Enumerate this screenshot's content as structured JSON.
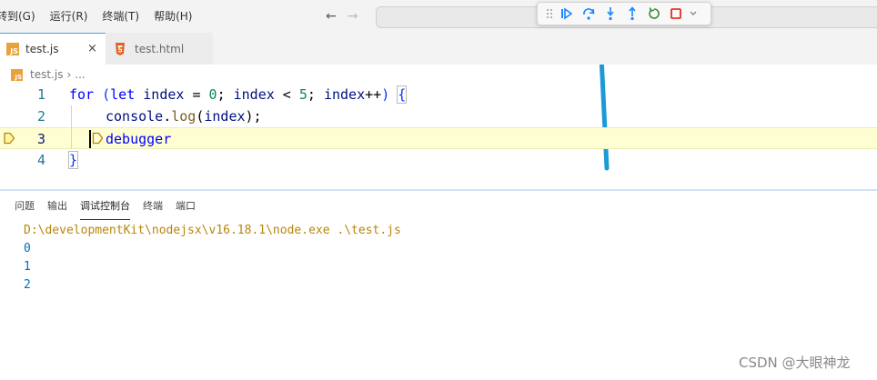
{
  "menu": {
    "items": [
      "转到(G)",
      "运行(R)",
      "终端(T)",
      "帮助(H)"
    ]
  },
  "nav": {
    "back": "←",
    "forward": "→"
  },
  "tabs": [
    {
      "label": "test.js",
      "close": "×"
    },
    {
      "label": "test.html"
    }
  ],
  "breadcrumb": {
    "file": "test.js",
    "separator": "›",
    "rest": "..."
  },
  "icons": {
    "js_glyph": "JS",
    "continue": "continue-icon",
    "step_over": "step-over-icon",
    "step_into": "step-into-icon",
    "step_out": "step-out-icon",
    "restart": "restart-icon",
    "stop": "stop-icon"
  },
  "editor": {
    "lines": [
      {
        "number": "1"
      },
      {
        "number": "2"
      },
      {
        "number": "3"
      },
      {
        "number": "4"
      }
    ],
    "tokens": {
      "l1_for": "for",
      "l1_paren": "(",
      "l1_let": "let",
      "l1_index": "index",
      "l1_eq": " = ",
      "l1_zero": "0",
      "l1_semi1": "; ",
      "l1_index2": "index",
      "l1_lt": " < ",
      "l1_five": "5",
      "l1_semi2": "; ",
      "l1_index3": "index",
      "l1_inc": "++",
      "l1_close": ")",
      "l1_brace": "{",
      "l2_console": "console",
      "l2_dot": ".",
      "l2_log": "log",
      "l2_open": "(",
      "l2_index": "index",
      "l2_close": ");",
      "l3_debugger": "debugger",
      "l4_brace": "}"
    }
  },
  "panel": {
    "tabs": [
      "问题",
      "输出",
      "调试控制台",
      "终端",
      "端口"
    ],
    "active_tab": "调试控制台",
    "console": {
      "path": "D:\\developmentKit\\nodejsx\\v16.18.1\\node.exe .\\test.js",
      "outputs": [
        "0",
        "1",
        "2"
      ]
    }
  },
  "watermark": "CSDN @大眼神龙",
  "colors": {
    "accent": "#4a9fe8",
    "annotation_arrow": "#1a9bd7",
    "debug_continue": "#1a85ff",
    "debug_restart": "#388a34",
    "debug_stop": "#e51400",
    "current_line": "#fffed3"
  }
}
